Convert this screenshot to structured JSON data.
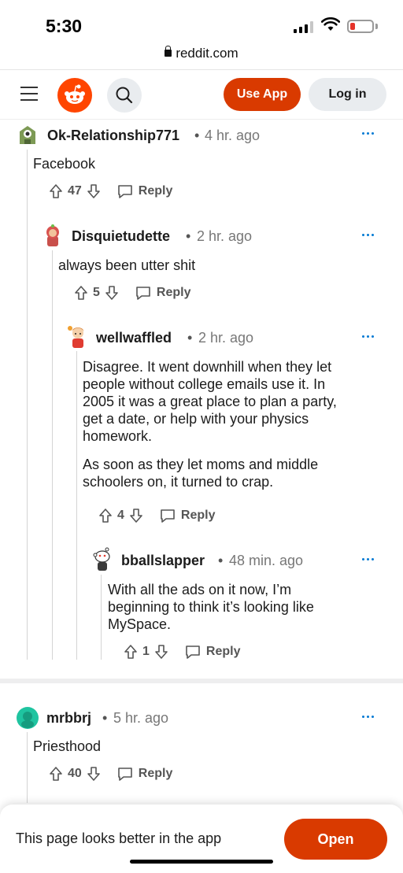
{
  "status": {
    "time": "5:30"
  },
  "browser": {
    "url": "reddit.com"
  },
  "header": {
    "use_app": "Use App",
    "log_in": "Log in"
  },
  "comments": [
    {
      "username": "Ok-Relationship771",
      "age": "4 hr. ago",
      "body": [
        "Facebook"
      ],
      "votes": "47",
      "reply": "Reply"
    },
    {
      "username": "Disquietudette",
      "age": "2 hr. ago",
      "body": [
        "always been utter shit"
      ],
      "votes": "5",
      "reply": "Reply"
    },
    {
      "username": "wellwaffled",
      "age": "2 hr. ago",
      "body": [
        "Disagree. It went downhill when they let",
        "people without college emails use it. In",
        "2005 it was a great place to plan a party,",
        "get a date, or help with your physics",
        "homework.",
        "As soon as they let moms and middle",
        "schoolers on, it turned to crap."
      ],
      "votes": "4",
      "reply": "Reply"
    },
    {
      "username": "bballslapper",
      "age": "48 min. ago",
      "body": [
        "With all the ads on it now, I’m",
        "beginning to think it’s looking like",
        "MySpace."
      ],
      "votes": "1",
      "reply": "Reply"
    },
    {
      "username": "mrbbrj",
      "age": "5 hr. ago",
      "body": [
        "Priesthood"
      ],
      "votes": "40",
      "reply": "Reply"
    }
  ],
  "banner": {
    "text": "This page looks better in the app",
    "open": "Open"
  },
  "colors": {
    "accent": "#d93a00",
    "logo": "#ff4500",
    "more_dots": "#0079d3"
  }
}
